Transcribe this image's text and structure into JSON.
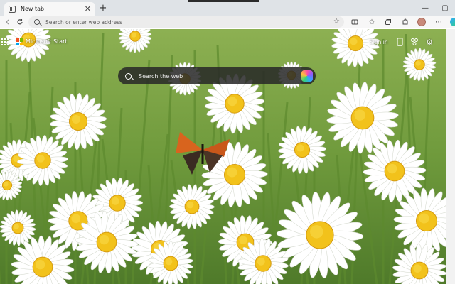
{
  "tab": {
    "title": "New tab",
    "close_glyph": "✕"
  },
  "window": {
    "minimize_glyph": "—",
    "maximize_glyph": "▢",
    "close_glyph": "✕",
    "newtab_glyph": "+"
  },
  "toolbar": {
    "address_placeholder": "Search or enter web address",
    "icons": [
      "back-icon",
      "refresh-icon",
      "search-icon",
      "star-icon",
      "split-screen-icon",
      "favorites-icon",
      "collections-icon",
      "extensions-icon",
      "avatar",
      "more-icon",
      "copilot-icon"
    ]
  },
  "ntp": {
    "brand": "Microsoft Start",
    "signin": "Sign in",
    "search_placeholder": "Search the web",
    "icons": [
      "apps-grid-icon",
      "microsoft-logo",
      "phone-icon",
      "rewards-icon",
      "settings-gear-icon",
      "copilot-icon"
    ]
  },
  "background": {
    "subject": "daisies with butterfly",
    "flower_petal": "#ffffff",
    "flower_center": "#f2c21b",
    "foliage": "#6f9a3c"
  }
}
